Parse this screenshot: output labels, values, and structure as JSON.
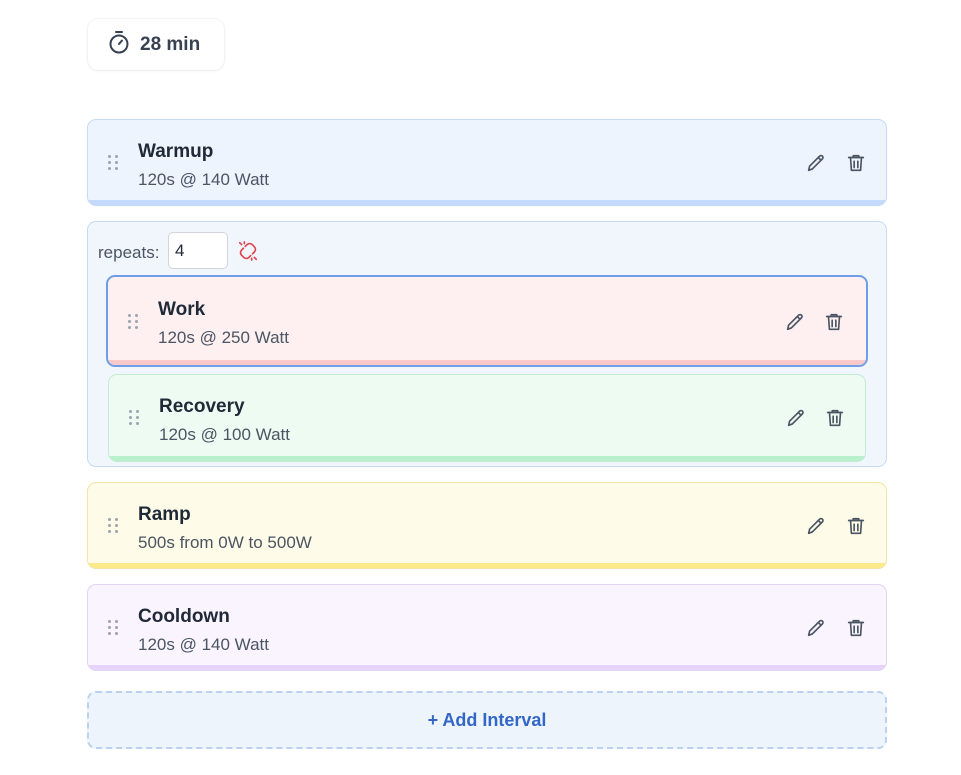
{
  "header": {
    "duration": "28 min",
    "icon": "timer-icon"
  },
  "intervals": [
    {
      "title": "Warmup",
      "detail": "120s @ 140 Watt",
      "bg": "#eef4fe",
      "border": "#c6dbf6",
      "bar": "#c3dafc"
    },
    {
      "title": "Ramp",
      "detail": "500s from 0W to 500W",
      "bg": "#fefbe8",
      "border": "#f2e6a3",
      "bar": "#fbe98a"
    },
    {
      "title": "Cooldown",
      "detail": "120s @ 140 Watt",
      "bg": "#f9f4fe",
      "border": "#e3d4f5",
      "bar": "#e6d4fc"
    }
  ],
  "group": {
    "repeats_label": "repeats:",
    "repeats_value": "4",
    "items": [
      {
        "title": "Work",
        "detail": "120s @ 250 Watt",
        "bg": "#fef0f0",
        "border": "#6f9ee8",
        "bar": "#fbc9c9",
        "selected": true
      },
      {
        "title": "Recovery",
        "detail": "120s @ 100 Watt",
        "bg": "#edfbf2",
        "border": "#c4ecd1",
        "bar": "#b7f0cb",
        "selected": false
      }
    ]
  },
  "add_button": {
    "label": "+ Add Interval"
  },
  "colors": {
    "accent": "#3267c7",
    "unlink": "#e0424e"
  }
}
